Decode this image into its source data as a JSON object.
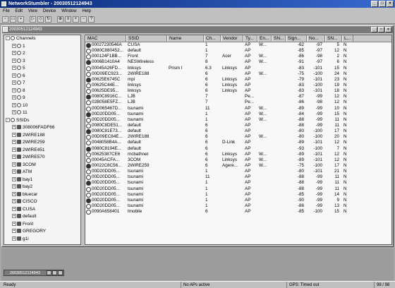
{
  "app": {
    "title": "NetworkStumbler - 20030512124943",
    "doc_title": "20030512124943"
  },
  "menu": [
    "File",
    "Edit",
    "View",
    "Device",
    "Window",
    "Help"
  ],
  "toolbar_icons": [
    "new-icon",
    "open-icon",
    "save-icon",
    "play-icon",
    "filter-icon",
    "refresh-icon",
    "gps-icon",
    "list-icon",
    "zoom-in-icon",
    "zoom-out-icon",
    "help-icon"
  ],
  "tree": [
    {
      "label": "Channels",
      "level": 0,
      "exp": "-",
      "icon": "network"
    },
    {
      "label": "1",
      "level": 1,
      "exp": "+",
      "icon": "network"
    },
    {
      "label": "2",
      "level": 1,
      "exp": "+",
      "icon": "network"
    },
    {
      "label": "3",
      "level": 1,
      "exp": "+",
      "icon": "network"
    },
    {
      "label": "5",
      "level": 1,
      "exp": "+",
      "icon": "network"
    },
    {
      "label": "6",
      "level": 1,
      "exp": "+",
      "icon": "network"
    },
    {
      "label": "7",
      "level": 1,
      "exp": "+",
      "icon": "network"
    },
    {
      "label": "8",
      "level": 1,
      "exp": "+",
      "icon": "network"
    },
    {
      "label": "9",
      "level": 1,
      "exp": "+",
      "icon": "network"
    },
    {
      "label": "10",
      "level": 1,
      "exp": "+",
      "icon": "network"
    },
    {
      "label": "11",
      "level": 1,
      "exp": "+",
      "icon": "network"
    },
    {
      "label": "SSIDs",
      "level": 0,
      "exp": "-",
      "icon": "network"
    },
    {
      "label": "308006FADF66",
      "level": 1,
      "exp": "+",
      "icon": "ap"
    },
    {
      "label": "2WIRE188",
      "level": 1,
      "exp": "+",
      "icon": "ap"
    },
    {
      "label": "2WIRE259",
      "level": 1,
      "exp": "+",
      "icon": "ap"
    },
    {
      "label": "2WIRE451",
      "level": 1,
      "exp": "+",
      "icon": "ap"
    },
    {
      "label": "2WIRE570",
      "level": 1,
      "exp": "+",
      "icon": "ap"
    },
    {
      "label": "3COM",
      "level": 1,
      "exp": "+",
      "icon": "ap"
    },
    {
      "label": "ATM",
      "level": 1,
      "exp": "+",
      "icon": "ap"
    },
    {
      "label": "bay1",
      "level": 1,
      "exp": "+",
      "icon": "ap"
    },
    {
      "label": "bay2",
      "level": 1,
      "exp": "+",
      "icon": "ap"
    },
    {
      "label": "bluecar",
      "level": 1,
      "exp": "+",
      "icon": "ap"
    },
    {
      "label": "CISCO",
      "level": 1,
      "exp": "+",
      "icon": "ap"
    },
    {
      "label": "CUSA",
      "level": 1,
      "exp": "+",
      "icon": "ap"
    },
    {
      "label": "default",
      "level": 1,
      "exp": "+",
      "icon": "ap"
    },
    {
      "label": "Front",
      "level": 1,
      "exp": "+",
      "icon": "ap"
    },
    {
      "label": "GREGORY",
      "level": 1,
      "exp": "+",
      "icon": "ap"
    },
    {
      "label": "g1i",
      "level": 1,
      "exp": "+",
      "icon": "ap"
    }
  ],
  "columns": [
    "MAC",
    "SSID",
    "Name",
    "Ch...",
    "Vendor",
    "Ty...",
    "En...",
    "SN...",
    "Sign...",
    "No...",
    "SN...",
    "L..."
  ],
  "rows": [
    [
      "00027230546A",
      "CUSA",
      "",
      "1",
      "",
      "AP",
      "W...",
      "",
      "-62",
      "-97",
      "5",
      "N"
    ],
    [
      "0080C880452...",
      "default",
      "",
      "1",
      "",
      "AP",
      "",
      "",
      "-85",
      "-97",
      "12",
      "N"
    ],
    [
      "000124F1BB...",
      "Front",
      "",
      "7",
      "Acer",
      "AP",
      "W...",
      "",
      "-86",
      "-98",
      "2",
      "N"
    ],
    [
      "0006B1410A4",
      "NESWireless",
      "",
      "8",
      "",
      "AP",
      "W...",
      "",
      "-91",
      "-97",
      "6",
      "N"
    ],
    [
      "00045A26FD...",
      "linksys",
      "Prism I",
      "6.3",
      "Linksys",
      "AP",
      "",
      "",
      "-83",
      "-101",
      "15",
      "N"
    ],
    [
      "00D09EC923...",
      "2WIRE188",
      "",
      "6",
      "",
      "AP",
      "W...",
      "",
      "-75",
      "-100",
      "24",
      "N"
    ],
    [
      "00625E6745C",
      "mpi",
      "",
      "6",
      "Linksys",
      "AP",
      "",
      "",
      "-79",
      "-101",
      "23",
      "N"
    ],
    [
      "00625C44E...",
      "linksys",
      "",
      "6",
      "Linksys",
      "AP",
      "",
      "",
      "-83",
      "-100",
      "19",
      "N"
    ],
    [
      "00625DE95...",
      "linksys",
      "",
      "6",
      "Linksys",
      "AP",
      "",
      "",
      "-83",
      "-101",
      "18",
      "N"
    ],
    [
      "0080C8916C...",
      "LJB",
      "",
      "7",
      "",
      "Pe...",
      "",
      "",
      "-87",
      "-99",
      "12",
      "N"
    ],
    [
      "02B058E5FZ...",
      "LJB",
      "",
      "7",
      "",
      "Pe...",
      "",
      "",
      "-86",
      "-98",
      "12",
      "N"
    ],
    [
      "00D065467D...",
      "tsunami",
      "",
      "11",
      "",
      "AP",
      "W...",
      "",
      "-89",
      "-99",
      "10",
      "N"
    ],
    [
      "00D20DD05...",
      "tsunami",
      "",
      "1",
      "",
      "AP",
      "W...",
      "",
      "-84",
      "-99",
      "15",
      "N"
    ],
    [
      "00D20DD05...",
      "tsunami",
      "",
      "1",
      "",
      "AP",
      "W...",
      "",
      "-88",
      "-99",
      "11",
      "N"
    ],
    [
      "0080C8DE51...",
      "default",
      "",
      "6",
      "",
      "AP",
      "",
      "",
      "-88",
      "-99",
      "11",
      "N"
    ],
    [
      "0080C81E73...",
      "default",
      "",
      "6",
      "",
      "AP",
      "",
      "",
      "-80",
      "-100",
      "17",
      "N"
    ],
    [
      "00D09EC84E...",
      "2WIRE188",
      "",
      "6",
      "",
      "AP",
      "W...",
      "",
      "-80",
      "-100",
      "20",
      "N"
    ],
    [
      "0048058B4A...",
      "default",
      "",
      "6",
      "D-Link",
      "AP",
      "",
      "",
      "-89",
      "-101",
      "12",
      "N"
    ],
    [
      "0080C8194E...",
      "default",
      "",
      "6",
      "",
      "AP",
      "",
      "",
      "-93",
      "-100",
      "7",
      "N"
    ],
    [
      "00625387CE6",
      "mcbathnet",
      "",
      "6",
      "Linksys",
      "AP",
      "W...",
      "",
      "-89",
      "-101",
      "12",
      "N"
    ],
    [
      "00045ACFA...",
      "3COM",
      "",
      "6",
      "Linksys",
      "AP",
      "W...",
      "",
      "-89",
      "-101",
      "12",
      "N"
    ],
    [
      "00022C8C56...",
      "2WIRE259",
      "",
      "6",
      "Agere...",
      "AP",
      "W...",
      "",
      "-75",
      "-100",
      "17",
      "N"
    ],
    [
      "00D20DD05...",
      "tsunami",
      "",
      "1",
      "",
      "AP",
      "",
      "",
      "-80",
      "-101",
      "21",
      "N"
    ],
    [
      "00D20DD05...",
      "tsunami",
      "",
      "11",
      "",
      "AP",
      "",
      "",
      "-88",
      "-99",
      "11",
      "N"
    ],
    [
      "00D20DD05...",
      "tsunami",
      "",
      "1",
      "",
      "AP",
      "",
      "",
      "-88",
      "-99",
      "11",
      "N"
    ],
    [
      "00D20DD05...",
      "tsunami",
      "",
      "1",
      "",
      "AP",
      "",
      "",
      "-88",
      "-99",
      "11",
      "N"
    ],
    [
      "00D20DD05...",
      "tsunami",
      "",
      "1",
      "",
      "AP",
      "",
      "",
      "-85",
      "-99",
      "14",
      "N"
    ],
    [
      "00D20DD05...",
      "tsunami",
      "",
      "1",
      "",
      "AP",
      "",
      "",
      "-90",
      "-99",
      "9",
      "N"
    ],
    [
      "00D20DD05...",
      "tsunami",
      "",
      "1",
      "",
      "AP",
      "",
      "",
      "-86",
      "-99",
      "13",
      "N"
    ],
    [
      "0090A658401",
      "tmobile",
      "",
      "6",
      "",
      "AP",
      "",
      "",
      "-85",
      "-100",
      "15",
      "N"
    ]
  ],
  "taskbar": {
    "label": "20030512124943"
  },
  "status": {
    "left": "Ready",
    "aps": "No APs active",
    "gps": "GPS: Timed out",
    "count": "98 / 98"
  }
}
